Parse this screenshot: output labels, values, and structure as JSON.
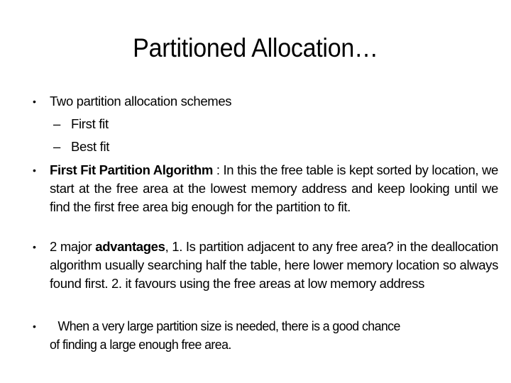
{
  "slide": {
    "title": "Partitioned Allocation…",
    "bullets": [
      {
        "marker": "•",
        "text": "Two partition allocation schemes",
        "sub_items": [
          {
            "marker": "–",
            "text": "First fit"
          },
          {
            "marker": "–",
            "text": "Best fit"
          }
        ]
      },
      {
        "marker": "•",
        "bold_lead": "First Fit Partition Algorithm",
        "text": " : In this the free table is kept sorted by location, we start at the free area at the lowest memory address and keep looking until we find the first free area big enough for the partition to fit."
      },
      {
        "marker": "•",
        "prefix": "2 major ",
        "bold_word": "advantages",
        "text": ", 1. Is partition adjacent to any free area? in the deallocation algorithm usually searching half the table, here lower memory location so always found first. 2. it favours using the free areas at low memory address"
      },
      {
        "marker": "•",
        "line1": "When a very large partition size is needed, there is a good chance",
        "line2": "of  finding a large enough free area."
      }
    ]
  }
}
